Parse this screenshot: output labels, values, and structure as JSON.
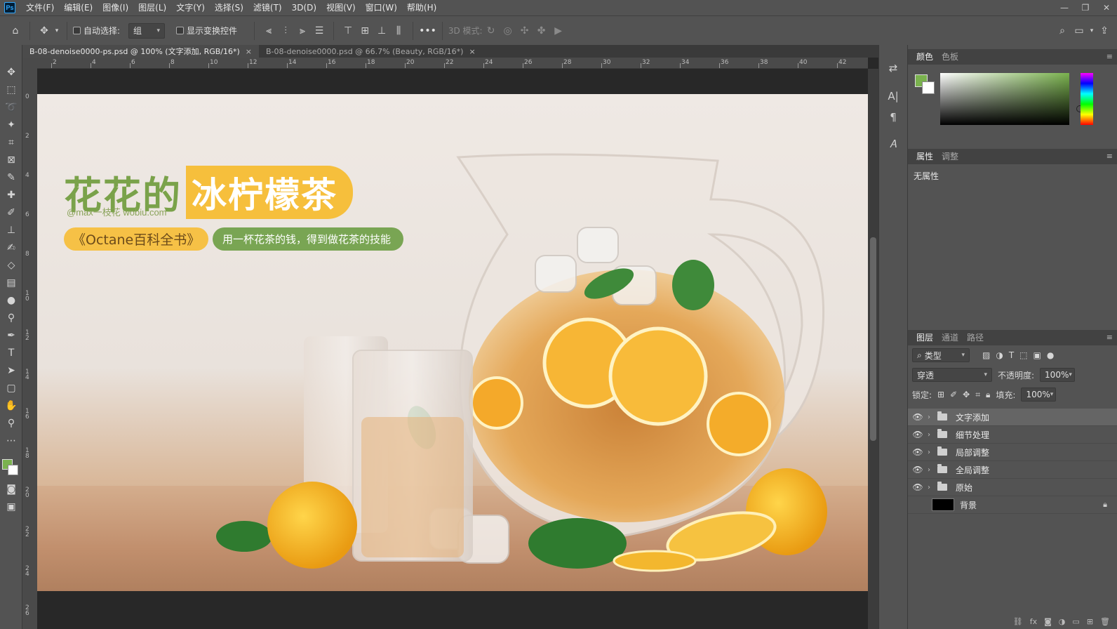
{
  "app": {
    "logo_text": "Ps"
  },
  "menu": [
    "文件(F)",
    "编辑(E)",
    "图像(I)",
    "图层(L)",
    "文字(Y)",
    "选择(S)",
    "滤镜(T)",
    "3D(D)",
    "视图(V)",
    "窗口(W)",
    "帮助(H)"
  ],
  "window_controls": {
    "minimize": "—",
    "restore": "❐",
    "close": "✕"
  },
  "options": {
    "auto_select_label": "自动选择:",
    "auto_select_value": "组",
    "show_transform_label": "显示变换控件",
    "more": "•••",
    "mode_3d_label": "3D 模式:"
  },
  "tabs": [
    {
      "label": "B-08-denoise0000-ps.psd @ 100% (文字添加, RGB/16*)",
      "close": "×",
      "active": true
    },
    {
      "label": "B-08-denoise0000.psd @ 66.7% (Beauty, RGB/16*)",
      "close": "×",
      "active": false
    }
  ],
  "ruler": {
    "top": [
      "2",
      "4",
      "6",
      "8",
      "10",
      "12",
      "14",
      "16",
      "18",
      "20",
      "22",
      "24",
      "26",
      "28",
      "30",
      "32",
      "34",
      "36",
      "38",
      "40",
      "42"
    ],
    "left": [
      "0",
      "2",
      "4",
      "6",
      "8",
      "1 0",
      "1 2",
      "1 4",
      "1 6",
      "1 8",
      "2 0",
      "2 2",
      "2 4",
      "2 6"
    ]
  },
  "artwork": {
    "title_green": "花花的",
    "title_yellow": "冰柠檬茶",
    "subtitle": "@max一枝花 wobiu.com",
    "pill_yellow": "《Octane百科全书》",
    "pill_green": "用一杯花茶的钱，得到做花茶的技能"
  },
  "color_panel": {
    "tabs": [
      "颜色",
      "色板"
    ],
    "fg": "#7ab24e",
    "bg": "#ffffff"
  },
  "properties_panel": {
    "tabs": [
      "属性",
      "调整"
    ],
    "empty_text": "无属性"
  },
  "layers_panel": {
    "tabs": [
      "图层",
      "通道",
      "路径"
    ],
    "filter_label": "类型",
    "blend_mode": "穿透",
    "opacity_label": "不透明度:",
    "opacity_value": "100%",
    "lock_label": "锁定:",
    "fill_label": "填充:",
    "fill_value": "100%",
    "layers": [
      {
        "name": "文字添加",
        "type": "group",
        "visible": true,
        "selected": true
      },
      {
        "name": "细节处理",
        "type": "group",
        "visible": true,
        "selected": false
      },
      {
        "name": "局部调整",
        "type": "group",
        "visible": true,
        "selected": false
      },
      {
        "name": "全局调整",
        "type": "group",
        "visible": true,
        "selected": false
      },
      {
        "name": "原始",
        "type": "group",
        "visible": true,
        "selected": false
      },
      {
        "name": "背景",
        "type": "pixel",
        "visible": false,
        "selected": false,
        "locked": true
      }
    ]
  },
  "colors": {
    "accent_green": "#7aa24a",
    "accent_yellow": "#f6bf3c",
    "ui_bg": "#535353",
    "pasteboard": "#282828"
  }
}
